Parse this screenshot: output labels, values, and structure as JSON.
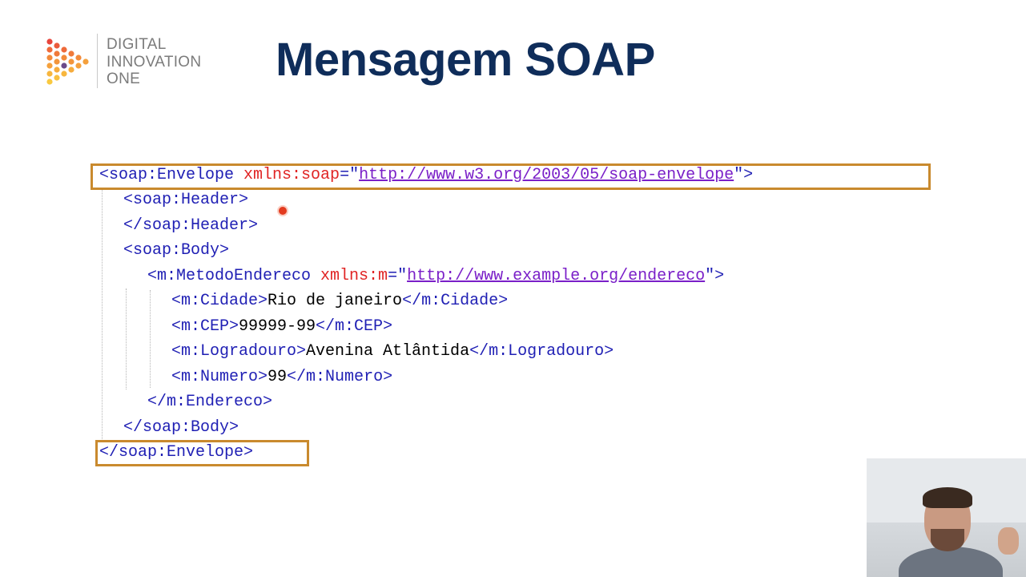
{
  "logo": {
    "lines": [
      "DIGITAL",
      "INNOVATION",
      "ONE"
    ]
  },
  "title": "Mensagem SOAP",
  "code": {
    "envelope_open": {
      "open": "<soap:Envelope ",
      "attr": "xmlns:soap",
      "eq": "=\"",
      "url": "http://www.w3.org/2003/05/soap-envelope",
      "close": "\">"
    },
    "header_open": "<soap:Header>",
    "header_close": "</soap:Header>",
    "body_open": "<soap:Body>",
    "metodo_open": {
      "open": "<m:MetodoEndereco ",
      "attr": "xmlns:m",
      "eq": "=\"",
      "url": "http://www.example.org/endereco",
      "close": "\">"
    },
    "cidade": {
      "open": "<m:Cidade>",
      "value": "Rio de janeiro",
      "close": "</m:Cidade>"
    },
    "cep": {
      "open": "<m:CEP>",
      "value": "99999-99",
      "close": "</m:CEP>"
    },
    "logradouro": {
      "open": "<m:Logradouro>",
      "value": "Avenina Atlântida",
      "close": "</m:Logradouro>"
    },
    "numero": {
      "open": "<m:Numero>",
      "value": "99",
      "close": "</m:Numero>"
    },
    "endereco_close": "</m:Endereco>",
    "body_close": "</soap:Body>",
    "envelope_close": "</soap:Envelope>"
  },
  "colors": {
    "title": "#0f2d5a",
    "tag": "#1f1fb4",
    "attribute": "#e02424",
    "url": "#7a1fc8",
    "highlight_box": "#c98a2e",
    "logo_text": "#7b7b7b"
  },
  "icons": {
    "logo": "dio-dot-triangle-logo",
    "pointer": "laser-pointer-dot"
  }
}
